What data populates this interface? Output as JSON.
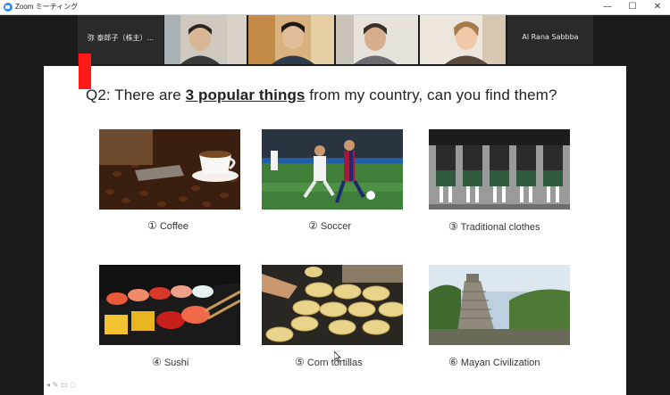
{
  "app": {
    "title": "Zoom ミーティング"
  },
  "window_controls": {
    "minimize": "—",
    "maximize": "☐",
    "close": "✕"
  },
  "participants": [
    {
      "name": "弥 泰郎子（株主）...",
      "video": false
    },
    {
      "label": "",
      "video": true
    },
    {
      "label": "",
      "video": true
    },
    {
      "label": "",
      "video": true
    },
    {
      "label": "",
      "video": true
    },
    {
      "name": "Al Rana Sabbba",
      "video": false
    }
  ],
  "slide": {
    "question_prefix": "Q2: There are ",
    "question_highlight": "3 popular things",
    "question_suffix": " from my country, can you find them?",
    "items": [
      {
        "num": "①",
        "label": "Coffee"
      },
      {
        "num": "②",
        "label": "Soccer"
      },
      {
        "num": "③",
        "label": "Traditional clothes"
      },
      {
        "num": "④",
        "label": "Sushi"
      },
      {
        "num": "⑤",
        "label": "Corn tortillas"
      },
      {
        "num": "⑥",
        "label": "Mayan Civilization"
      }
    ]
  },
  "colors": {
    "accent_red": "#ff1a1a",
    "zoom_blue": "#2d8cff"
  }
}
